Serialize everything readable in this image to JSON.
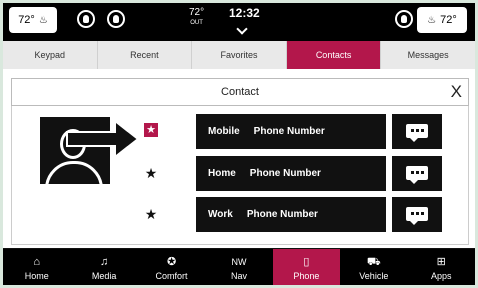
{
  "status_bar": {
    "left_temp": "72°",
    "center_temp": "72°",
    "center_temp_sub": "OUT",
    "time": "12:32",
    "right_temp": "72°"
  },
  "tabs": [
    {
      "label": "Keypad"
    },
    {
      "label": "Recent"
    },
    {
      "label": "Favorites"
    },
    {
      "label": "Contacts",
      "active": true
    },
    {
      "label": "Messages"
    }
  ],
  "dialog": {
    "title": "Contact",
    "close_label": "X"
  },
  "phone_rows": [
    {
      "type": "Mobile",
      "label": "Phone Number",
      "favorite": true
    },
    {
      "type": "Home",
      "label": "Phone Number",
      "favorite": false
    },
    {
      "type": "Work",
      "label": "Phone Number",
      "favorite": false
    }
  ],
  "nav": [
    {
      "label": "Home",
      "icon": "home-icon",
      "glyph": "⌂"
    },
    {
      "label": "Media",
      "icon": "music-note-icon",
      "glyph": "♫"
    },
    {
      "label": "Comfort",
      "icon": "seat-icon",
      "glyph": "✪"
    },
    {
      "label": "Nav",
      "icon": "compass-icon",
      "glyph": "NW"
    },
    {
      "label": "Phone",
      "icon": "phone-icon",
      "glyph": "▯",
      "active": true
    },
    {
      "label": "Vehicle",
      "icon": "car-icon",
      "glyph": "⛟"
    },
    {
      "label": "Apps",
      "icon": "apps-grid-icon",
      "glyph": "⊞"
    }
  ],
  "colors": {
    "accent": "#b3174b",
    "bar": "#000000",
    "row_bg": "#111111"
  }
}
